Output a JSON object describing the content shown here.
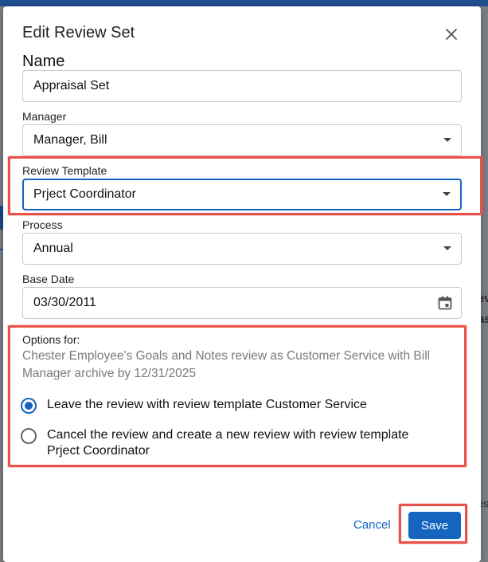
{
  "dialog": {
    "title": "Edit Review Set",
    "close_icon": "close-icon"
  },
  "name": {
    "heading": "Name",
    "value": "Appraisal Set"
  },
  "manager": {
    "label": "Manager",
    "value": "Manager, Bill"
  },
  "review_template": {
    "label": "Review Template",
    "value": "Prject Coordinator"
  },
  "process": {
    "label": "Process",
    "value": "Annual"
  },
  "base_date": {
    "label": "Base Date",
    "value": "03/30/2011",
    "icon": "calendar-icon"
  },
  "options": {
    "label": "Options for:",
    "description": "Chester Employee's Goals and Notes review as Customer Service with Bill Manager archive by 12/31/2025",
    "choices": [
      {
        "label": "Leave the review with review template Customer Service",
        "selected": true
      },
      {
        "label": "Cancel the review and create a new review with review template Prject Coordinator",
        "selected": false
      }
    ]
  },
  "actions": {
    "cancel_label": "Cancel",
    "save_label": "Save"
  },
  "background": {
    "fragments": [
      "ev",
      "as",
      "es"
    ]
  },
  "colors": {
    "accent": "#1565c0",
    "highlight": "#e8524a"
  }
}
